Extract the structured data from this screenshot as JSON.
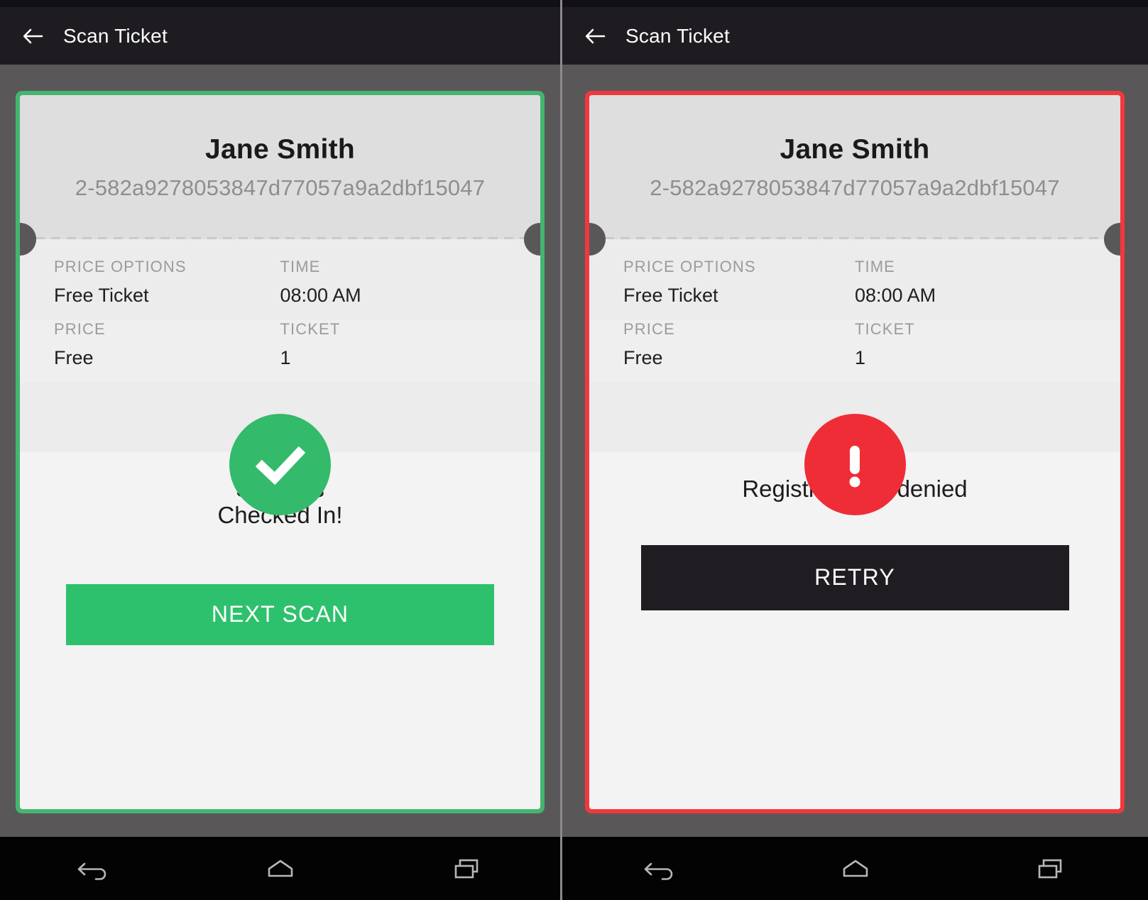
{
  "app": {
    "title_left": "Scan Ticket",
    "title_right": "Scan Ticket",
    "back_icon": "back-arrow-icon"
  },
  "ticket": {
    "attendee_name": "Jane Smith",
    "code": "2-582a9278053847d77057a9a2dbf15047",
    "labels": {
      "price_options": "PRICE OPTIONS",
      "time": "TIME",
      "price": "PRICE",
      "ticket": "TICKET"
    },
    "values": {
      "price_options": "Free Ticket",
      "time": "08:00 AM",
      "price": "Free",
      "ticket": "1"
    }
  },
  "left_panel": {
    "status_icon": "check-circle-icon",
    "status_line1": "Success",
    "status_line2": "Checked In!",
    "button_label": "NEXT SCAN",
    "accent_color": "#44b56f",
    "button_color": "#2ec16d",
    "icon_color": "#33ba6a"
  },
  "right_panel": {
    "status_icon": "error-circle-icon",
    "status_line1": "Registration is denied",
    "status_line2": "",
    "button_label": "RETRY",
    "accent_color": "#f2383c",
    "button_color": "#201d22",
    "icon_color": "#ef2d37"
  },
  "navbar": {
    "back": "nav-back-icon",
    "home": "nav-home-icon",
    "recents": "nav-recents-icon"
  }
}
